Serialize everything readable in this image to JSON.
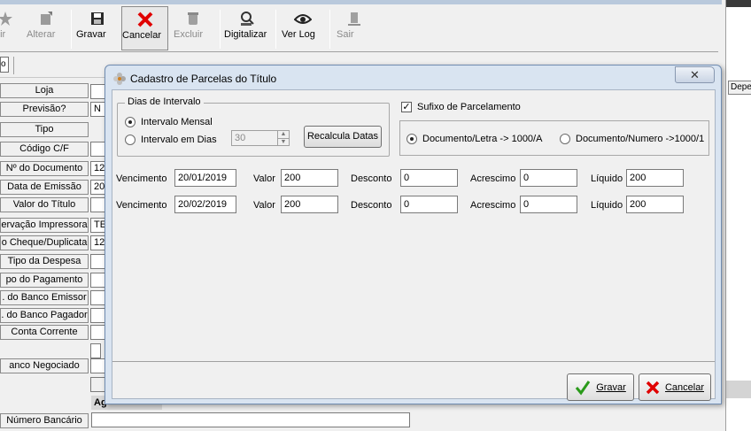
{
  "toolbar": {
    "buttons": [
      {
        "label": "uir",
        "enabled": false
      },
      {
        "label": "Alterar",
        "enabled": false
      },
      {
        "label": "Gravar",
        "enabled": true
      },
      {
        "label": "Cancelar",
        "enabled": true
      },
      {
        "label": "Excluir",
        "enabled": false
      },
      {
        "label": "Digitalizar",
        "enabled": true
      },
      {
        "label": "Ver Log",
        "enabled": true
      },
      {
        "label": "Sair",
        "enabled": false
      }
    ]
  },
  "subbar": {
    "small_box": "o"
  },
  "form": {
    "labels": [
      "Loja",
      "Previsão?",
      "Tipo",
      "Código C/F",
      "Nº do Documento",
      "Data de Emissão",
      "Valor do Título",
      "ervação Impressora",
      "o Cheque/Duplicata",
      "Tipo da Despesa",
      "po do Pagamento",
      ". do Banco Emissor",
      ". do Banco Pagador",
      "Conta Corrente",
      "anco Negociado",
      "Número Bancário"
    ],
    "values": {
      "previsao": "N",
      "documento": "12",
      "emissao": "20",
      "impressora": "TE",
      "cheque": "12"
    },
    "ag_label": "Ag"
  },
  "right_panel": {
    "header": "Depe"
  },
  "dialog": {
    "title": "Cadastro de Parcelas do Título",
    "close": "✕",
    "interval_group": {
      "legend": "Dias de Intervalo",
      "option_monthly": "Intervalo Mensal",
      "option_days": "Intervalo em Dias",
      "selected": "monthly",
      "days_value": "30",
      "recalc_button": "Recalcula Datas"
    },
    "suffix": {
      "checkbox_label": "Sufixo de Parcelamento",
      "checked": true,
      "option_letter": "Documento/Letra -> 1000/A",
      "option_number": "Documento/Numero ->1000/1",
      "selected": "letter"
    },
    "columns": {
      "vencimento": "Vencimento",
      "valor": "Valor",
      "desconto": "Desconto",
      "acrescimo": "Acrescimo",
      "liquido": "Líquido"
    },
    "rows": [
      {
        "vencimento": "20/01/2019",
        "valor": "200",
        "desconto": "0",
        "acrescimo": "0",
        "liquido": "200"
      },
      {
        "vencimento": "20/02/2019",
        "valor": "200",
        "desconto": "0",
        "acrescimo": "0",
        "liquido": "200"
      }
    ],
    "footer": {
      "save": "Gravar",
      "cancel": "Cancelar"
    }
  }
}
